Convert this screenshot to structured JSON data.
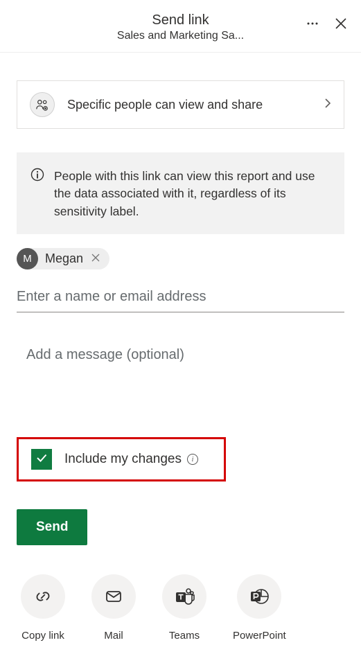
{
  "header": {
    "title": "Send link",
    "subtitle": "Sales and Marketing Sa..."
  },
  "link_settings": {
    "description": "Specific people can view and share"
  },
  "info_notice": {
    "text": "People with this link can view this report and use the data associated with it, regardless of its sensitivity label."
  },
  "recipient": {
    "avatar_initial": "M",
    "name": "Megan"
  },
  "inputs": {
    "name_placeholder": "Enter a name or email address",
    "message_placeholder": "Add a message (optional)"
  },
  "include_changes": {
    "label": "Include my changes",
    "checked": true
  },
  "send_button": "Send",
  "share_options": [
    {
      "id": "copy-link",
      "label": "Copy link"
    },
    {
      "id": "mail",
      "label": "Mail"
    },
    {
      "id": "teams",
      "label": "Teams"
    },
    {
      "id": "powerpoint",
      "label": "PowerPoint"
    }
  ]
}
